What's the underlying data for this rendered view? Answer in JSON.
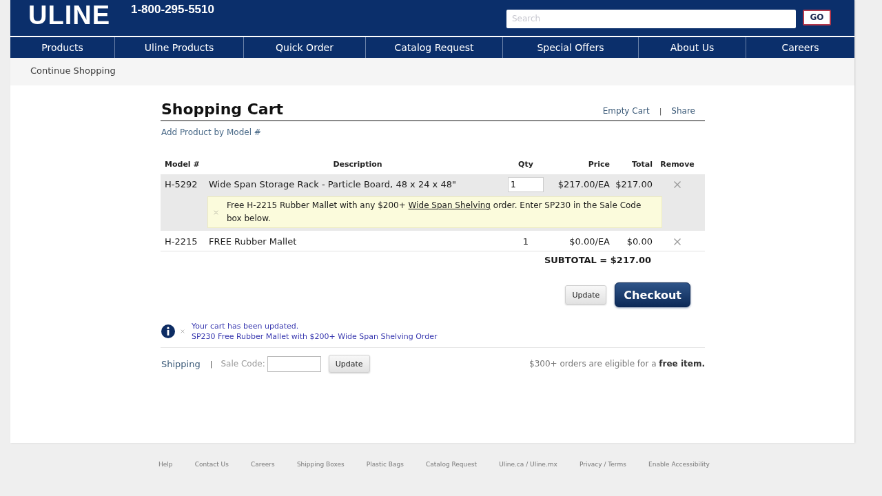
{
  "header": {
    "logo": "ULINE",
    "phone": "1-800-295-5510",
    "search": {
      "placeholder": "Search"
    },
    "search_button": "GO"
  },
  "nav": [
    "Products",
    "Uline Products",
    "Quick Order",
    "Catalog Request",
    "Special Offers",
    "About Us",
    "Careers"
  ],
  "continue_shopping": "Continue Shopping",
  "cart": {
    "title": "Shopping Cart",
    "actions": [
      "Empty Cart",
      "Share"
    ],
    "actions_separator": "|",
    "add_product_link": "Add Product by Model #",
    "table": {
      "columns": [
        "Model #",
        "Description",
        "Qty",
        "Price",
        "Total",
        "Remove"
      ],
      "rows": [
        {
          "model": "H-5292",
          "description": "Wide Span Storage Rack - Particle Board, 48 x 24 x 48\"",
          "qty": "1",
          "kind": "editable",
          "price": "$217.00/EA",
          "total": "$217.00",
          "highlighted": true,
          "promo": {
            "text_before": "Free H-2215 Rubber Mallet with any $200+ ",
            "link": "Wide Span Shelving",
            "text_after": " order. Enter SP230 in the Sale Code box below."
          }
        },
        {
          "model": "H-2215",
          "description": "FREE Rubber Mallet",
          "qty": "1",
          "kind": "fixed",
          "price": "$0.00/EA",
          "total": "$0.00",
          "highlighted": false
        }
      ]
    },
    "subtotal": "SUBTOTAL = $217.00",
    "buttons": [
      {
        "label": "Update",
        "kind": "secondary"
      },
      {
        "label": "Checkout",
        "kind": "primary"
      }
    ],
    "message": {
      "lines": [
        "Your cart has been updated.",
        "SP230 Free Rubber Mallet with $200+ Wide Span Shelving Order"
      ]
    },
    "sale_code": {
      "shipping_link": "Shipping",
      "separator": "|",
      "label": "Sale Code:",
      "button": "Update"
    },
    "free_item_note": "$300+ orders are eligible for a **free item.**"
  },
  "footer": {
    "links": [
      "Help",
      "Contact Us",
      "Careers",
      "Shipping Boxes",
      "Plastic Bags",
      "Catalog Request",
      "Uline.ca / Uline.mx",
      "Privacy / Terms",
      "Enable Accessibility"
    ]
  }
}
